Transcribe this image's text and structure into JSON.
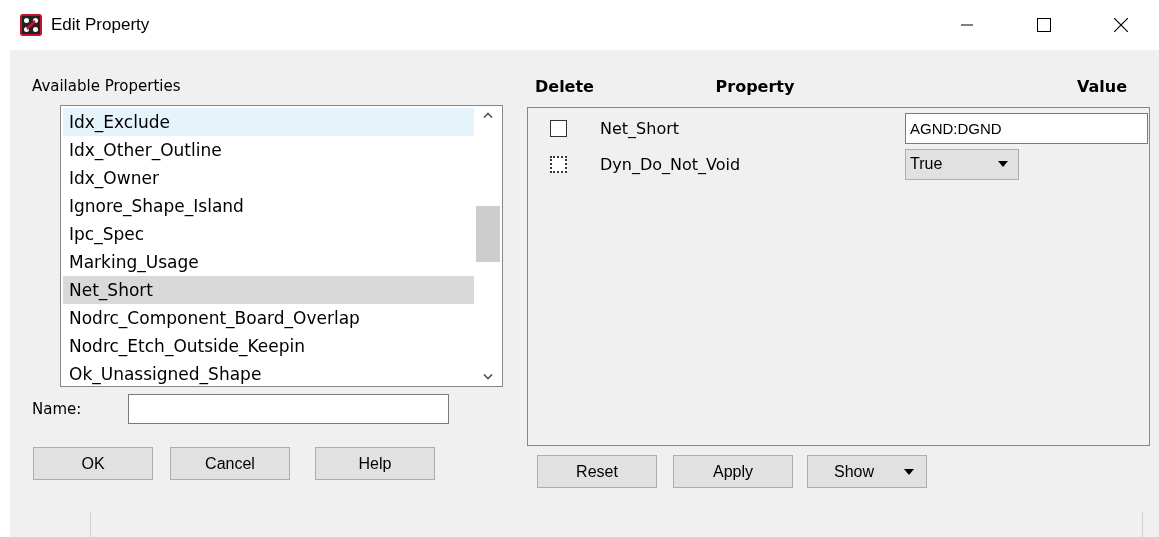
{
  "window": {
    "title": "Edit Property"
  },
  "available_properties": {
    "label": "Available Properties",
    "items": [
      {
        "label": "Idx_Exclude",
        "selected": false,
        "hovered": true
      },
      {
        "label": "Idx_Other_Outline",
        "selected": false,
        "hovered": false
      },
      {
        "label": "Idx_Owner",
        "selected": false,
        "hovered": false
      },
      {
        "label": "Ignore_Shape_Island",
        "selected": false,
        "hovered": false
      },
      {
        "label": "Ipc_Spec",
        "selected": false,
        "hovered": false
      },
      {
        "label": "Marking_Usage",
        "selected": false,
        "hovered": false
      },
      {
        "label": "Net_Short",
        "selected": true,
        "hovered": false
      },
      {
        "label": "Nodrc_Component_Board_Overlap",
        "selected": false,
        "hovered": false
      },
      {
        "label": "Nodrc_Etch_Outside_Keepin",
        "selected": false,
        "hovered": false
      },
      {
        "label": "Ok_Unassigned_Shape",
        "selected": false,
        "hovered": false
      }
    ]
  },
  "name_field": {
    "label": "Name:"
  },
  "left_buttons": [
    "OK",
    "Cancel",
    "Help"
  ],
  "table": {
    "columns": [
      "Delete",
      "Property",
      "Value"
    ],
    "rows": [
      {
        "checked": false,
        "focused": false,
        "property": "Net_Short",
        "kind": "text",
        "value": "AGND:DGND"
      },
      {
        "checked": false,
        "focused": true,
        "property": "Dyn_Do_Not_Void",
        "kind": "dropdown",
        "value": "True"
      }
    ]
  },
  "right_buttons": [
    {
      "label": "Reset",
      "kind": "plain"
    },
    {
      "label": "Apply",
      "kind": "plain"
    },
    {
      "label": "Show",
      "kind": "menu"
    }
  ]
}
